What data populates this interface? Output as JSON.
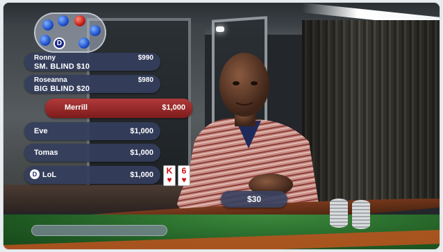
{
  "players": [
    {
      "name": "Ronny",
      "stack": "$990",
      "blind": "SM. BLIND $10"
    },
    {
      "name": "Roseanna",
      "stack": "$980",
      "blind": "BIG BLIND $20"
    },
    {
      "name": "Merrill",
      "stack": "$1,000",
      "active": true
    },
    {
      "name": "Eve",
      "stack": "$1,000"
    },
    {
      "name": "Tomas",
      "stack": "$1,000"
    },
    {
      "name": "LoL",
      "stack": "$1,000",
      "dealer": true,
      "cards": [
        {
          "rank": "K",
          "suit": "♥"
        },
        {
          "rank": "6",
          "suit": "♥"
        }
      ]
    }
  ],
  "seat_map": {
    "dealer_badge": "D"
  },
  "pot": "$30",
  "colors": {
    "active_player": "#9a2626",
    "player_panel": "#343e5c",
    "card_red": "#d40d12"
  }
}
